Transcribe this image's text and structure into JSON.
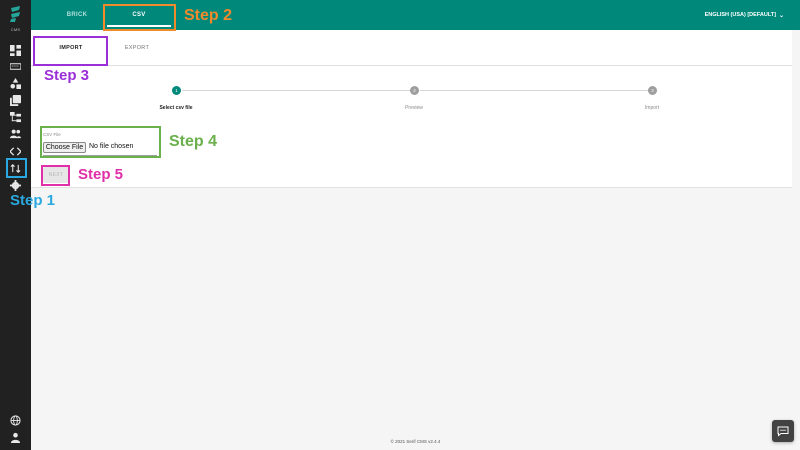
{
  "sidebar": {
    "app_label": "CMS",
    "items": [
      {
        "icon": "dashboard-icon"
      },
      {
        "icon": "keyboard-icon"
      },
      {
        "icon": "shapes-icon"
      },
      {
        "icon": "layers-icon"
      },
      {
        "icon": "hierarchy-icon"
      },
      {
        "icon": "users-icon"
      },
      {
        "icon": "code-icon"
      },
      {
        "icon": "import-export-icon",
        "active": true
      },
      {
        "icon": "gear-icon"
      }
    ],
    "bottom": [
      {
        "icon": "globe-icon"
      },
      {
        "icon": "account-icon"
      }
    ]
  },
  "header": {
    "tabs": [
      {
        "label": "BRICK",
        "active": false
      },
      {
        "label": "CSV",
        "active": true
      }
    ],
    "language": "ENGLISH (USA) [DEFAULT]"
  },
  "subtabs": [
    {
      "label": "IMPORT",
      "active": true
    },
    {
      "label": "EXPORT",
      "active": false
    }
  ],
  "stepper": {
    "steps": [
      {
        "number": "1",
        "label": "Select csv file",
        "active": true
      },
      {
        "number": "2",
        "label": "Preview",
        "active": false
      },
      {
        "number": "3",
        "label": "Import",
        "active": false
      }
    ]
  },
  "file_input": {
    "caption": "CSV File",
    "button_label": "Choose File",
    "status": "No file chosen"
  },
  "next_button": {
    "label": "NEXT",
    "disabled": true
  },
  "annotations": [
    {
      "label": "Step 1",
      "color": "#29a9e0"
    },
    {
      "label": "Step 2",
      "color": "#f08a2b"
    },
    {
      "label": "Step 3",
      "color": "#9b2fd8"
    },
    {
      "label": "Step 4",
      "color": "#6ab04c"
    },
    {
      "label": "Step 5",
      "color": "#e02fa8"
    }
  ],
  "footer": "© 2021 Serif CMS v2.4.4",
  "colors": {
    "primary": "#00897b",
    "sidebar": "#212121",
    "background": "#f5f5f5"
  }
}
